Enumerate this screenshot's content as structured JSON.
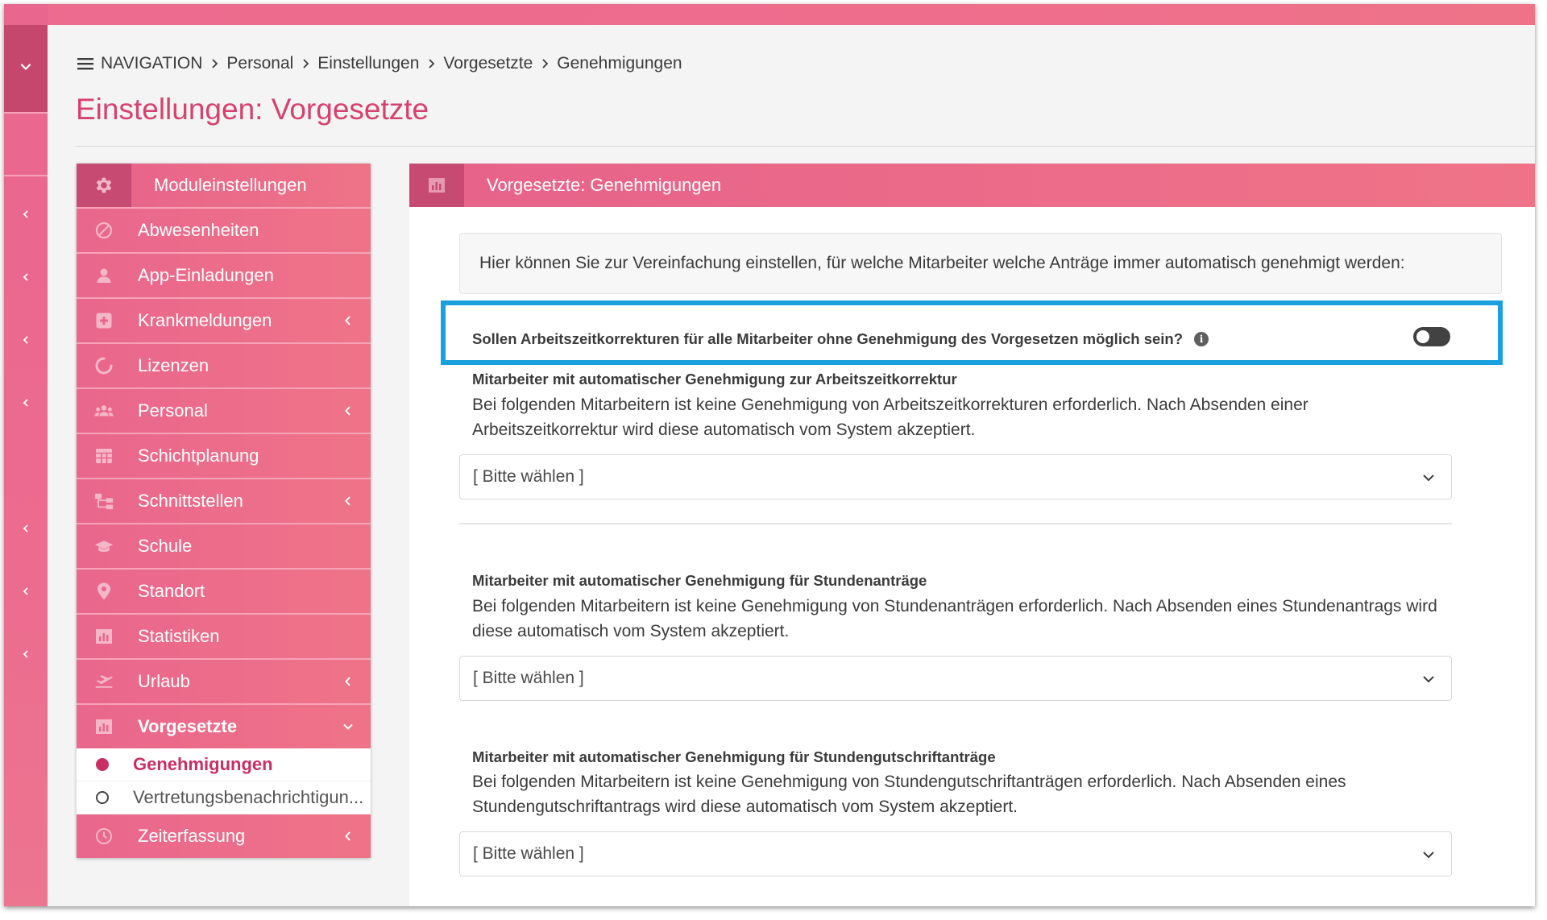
{
  "breadcrumb": {
    "nav_label": "NAVIGATION",
    "items": [
      "Personal",
      "Einstellungen",
      "Vorgesetzte",
      "Genehmigungen"
    ]
  },
  "page_title": "Einstellungen: Vorgesetzte",
  "sidebar": {
    "header": "Moduleinstellungen",
    "items": [
      {
        "label": "Abwesenheiten",
        "icon": "ban-icon"
      },
      {
        "label": "App-Einladungen",
        "icon": "user-icon"
      },
      {
        "label": "Krankmeldungen",
        "icon": "medical-plus-icon",
        "expandable": true
      },
      {
        "label": "Lizenzen",
        "icon": "circle-notch-icon"
      },
      {
        "label": "Personal",
        "icon": "users-icon",
        "expandable": true
      },
      {
        "label": "Schichtplanung",
        "icon": "table-icon"
      },
      {
        "label": "Schnittstellen",
        "icon": "sitemap-icon",
        "expandable": true
      },
      {
        "label": "Schule",
        "icon": "graduation-cap-icon"
      },
      {
        "label": "Standort",
        "icon": "map-marker-icon"
      },
      {
        "label": "Statistiken",
        "icon": "bar-chart-icon"
      },
      {
        "label": "Urlaub",
        "icon": "plane-departure-icon",
        "expandable": true
      },
      {
        "label": "Vorgesetzte",
        "icon": "bar-chart-icon",
        "expanded": true
      }
    ],
    "subitems": [
      {
        "label": "Genehmigungen",
        "active": true
      },
      {
        "label": "Vertretungsbenachrichtigun...",
        "active": false
      }
    ],
    "last_item": {
      "label": "Zeiterfassung",
      "icon": "clock-icon",
      "expandable": true
    }
  },
  "panel": {
    "header": "Vorgesetzte: Genehmigungen",
    "info": "Hier können Sie zur Vereinfachung einstellen, für welche Mitarbeiter welche Anträge immer automatisch genehmigt werden:",
    "toggle_question": "Sollen Arbeitszeitkorrekturen für alle Mitarbeiter ohne Genehmigung des Vorgesetzen möglich sein?",
    "toggle_on": false,
    "sections": [
      {
        "title": "Mitarbeiter mit automatischer Genehmigung zur Arbeitszeitkorrektur",
        "desc": "Bei folgenden Mitarbeitern ist keine Genehmigung von Arbeitszeitkorrekturen erforderlich. Nach Absenden einer Arbeitszeitkorrektur wird diese automatisch vom System akzeptiert.",
        "select_value": "[ Bitte wählen ]"
      },
      {
        "title": "Mitarbeiter mit automatischer Genehmigung für Stundenanträge",
        "desc": "Bei folgenden Mitarbeitern ist keine Genehmigung von Stundenanträgen erforderlich. Nach Absenden eines Stundenantrags wird diese automatisch vom System akzeptiert.",
        "select_value": "[ Bitte wählen ]"
      },
      {
        "title": "Mitarbeiter mit automatischer Genehmigung für Stundengutschriftanträge",
        "desc": "Bei folgenden Mitarbeitern ist keine Genehmigung von Stundengutschriftanträgen erforderlich. Nach Absenden eines Stundengutschriftantrags wird diese automatisch vom System akzeptiert.",
        "select_value": "[ Bitte wählen ]"
      }
    ]
  },
  "colors": {
    "brand_pink": "#ec6b8f",
    "brand_dark": "#c74a72",
    "title_pink": "#d6426f",
    "active_sub": "#c92f62",
    "highlight_blue": "#1aa0dd"
  }
}
